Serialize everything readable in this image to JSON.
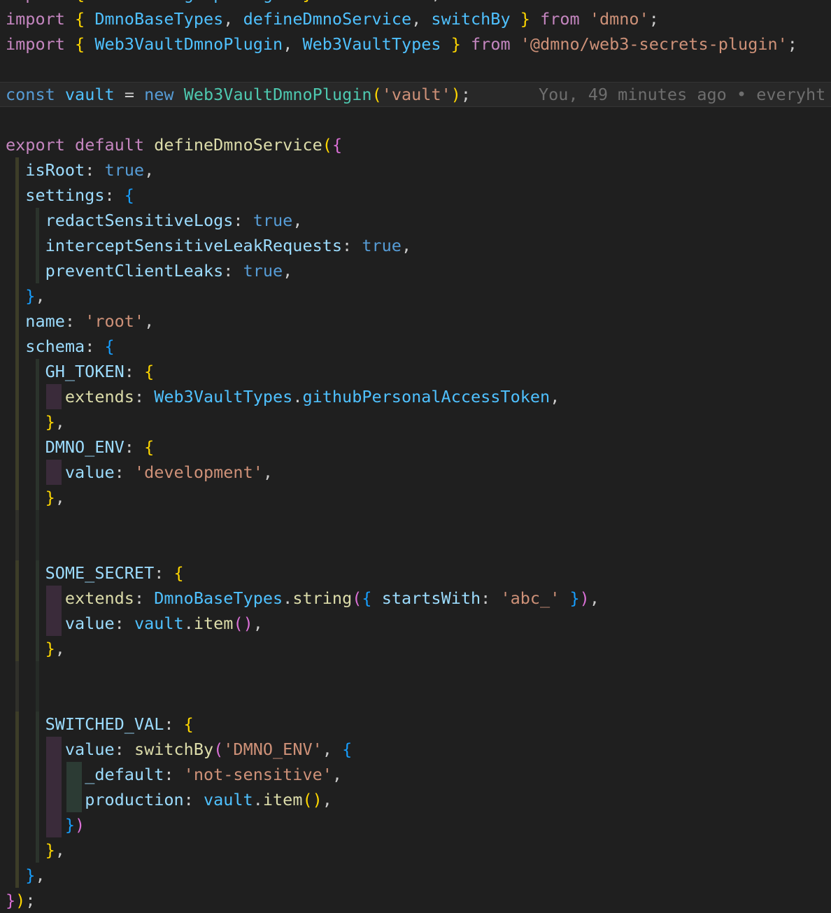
{
  "editor": {
    "language": "typescript",
    "file_kind": "dmno config",
    "background_color": "#1f1f1f",
    "current_line_background": "#282828",
    "font_size_px": 23.5,
    "line_height_px": 36
  },
  "blame": {
    "text": "You, 49 minutes ago • everyht",
    "author": "You",
    "when": "49 minutes ago",
    "message_fragment": "everyht",
    "separator": "•",
    "color": "#6e6e6e",
    "on_line": "const vault = new Web3VaultDmnoPlugin('vault');"
  },
  "colors": {
    "keyword": "#c586c0",
    "keyword_control": "#569cd6",
    "identifier": "#9cdcfe",
    "function": "#dcdcaa",
    "class": "#4ec9b0",
    "type": "#4fc1ff",
    "string": "#ce9178",
    "punctuation": "#cccccc",
    "bracket_level_1": "#ffd700",
    "bracket_level_2": "#da70d6",
    "bracket_level_3": "#179fff",
    "indent_guide_1": "#3d3d28",
    "indent_guide_2": "#2b332c",
    "indent_guide_3": "#3a2b3a",
    "indent_guide_4": "#2c3b34"
  },
  "code": {
    "lines": [
      {
        "n": 0,
        "text": "import { DmnoConfigraphPlugin } from 'dmno';",
        "clipped": true
      },
      {
        "n": 1,
        "text": "import { DmnoBaseTypes, defineDmnoService, switchBy } from 'dmno';"
      },
      {
        "n": 2,
        "text": "import { Web3VaultDmnoPlugin, Web3VaultTypes } from '@dmno/web3-secrets-plugin';"
      },
      {
        "n": 3,
        "text": ""
      },
      {
        "n": 4,
        "text": "const vault = new Web3VaultDmnoPlugin('vault');",
        "current": true
      },
      {
        "n": 5,
        "text": ""
      },
      {
        "n": 6,
        "text": "export default defineDmnoService({"
      },
      {
        "n": 7,
        "text": "  isRoot: true,"
      },
      {
        "n": 8,
        "text": "  settings: {"
      },
      {
        "n": 9,
        "text": "    redactSensitiveLogs: true,"
      },
      {
        "n": 10,
        "text": "    interceptSensitiveLeakRequests: true,"
      },
      {
        "n": 11,
        "text": "    preventClientLeaks: true,"
      },
      {
        "n": 12,
        "text": "  },"
      },
      {
        "n": 13,
        "text": "  name: 'root',"
      },
      {
        "n": 14,
        "text": "  schema: {"
      },
      {
        "n": 15,
        "text": "    GH_TOKEN: {"
      },
      {
        "n": 16,
        "text": "      extends: Web3VaultTypes.githubPersonalAccessToken,"
      },
      {
        "n": 17,
        "text": "    },"
      },
      {
        "n": 18,
        "text": "    DMNO_ENV: {"
      },
      {
        "n": 19,
        "text": "      value: 'development',"
      },
      {
        "n": 20,
        "text": "    },"
      },
      {
        "n": 21,
        "text": ""
      },
      {
        "n": 22,
        "text": ""
      },
      {
        "n": 23,
        "text": "    SOME_SECRET: {"
      },
      {
        "n": 24,
        "text": "      extends: DmnoBaseTypes.string({ startsWith: 'abc_' }),"
      },
      {
        "n": 25,
        "text": "      value: vault.item(),"
      },
      {
        "n": 26,
        "text": "    },"
      },
      {
        "n": 27,
        "text": ""
      },
      {
        "n": 28,
        "text": ""
      },
      {
        "n": 29,
        "text": "    SWITCHED_VAL: {"
      },
      {
        "n": 30,
        "text": "      value: switchBy('DMNO_ENV', {"
      },
      {
        "n": 31,
        "text": "        _default: 'not-sensitive',"
      },
      {
        "n": 32,
        "text": "        production: vault.item(),"
      },
      {
        "n": 33,
        "text": "      })"
      },
      {
        "n": 34,
        "text": "    },"
      },
      {
        "n": 35,
        "text": "  },"
      },
      {
        "n": 36,
        "text": "});"
      }
    ]
  },
  "tokens": {
    "imports": {
      "keyword_import": "import",
      "keyword_from": "from",
      "named_1": [
        "DmnoBaseTypes",
        "defineDmnoService",
        "switchBy"
      ],
      "module_1": "'dmno'",
      "named_2": [
        "Web3VaultDmnoPlugin",
        "Web3VaultTypes"
      ],
      "module_2": "'@dmno/web3-secrets-plugin'"
    },
    "vault_decl": {
      "keyword_const": "const",
      "name": "vault",
      "keyword_new": "new",
      "class": "Web3VaultDmnoPlugin",
      "arg": "'vault'"
    },
    "service": {
      "keyword_export": "export",
      "keyword_default": "default",
      "fn": "defineDmnoService",
      "isRoot": "true",
      "settings_keys": [
        "redactSensitiveLogs",
        "interceptSensitiveLeakRequests",
        "preventClientLeaks"
      ],
      "settings_values": [
        "true",
        "true",
        "true"
      ],
      "name_value": "'root'",
      "schema_keys": [
        "GH_TOKEN",
        "DMNO_ENV",
        "SOME_SECRET",
        "SWITCHED_VAL"
      ],
      "gh_token_extends": "Web3VaultTypes.githubPersonalAccessToken",
      "dmno_env_value": "'development'",
      "some_secret_extends": "DmnoBaseTypes.string({ startsWith: 'abc_' })",
      "some_secret_value": "vault.item()",
      "switched_val_fn": "switchBy",
      "switched_val_arg": "'DMNO_ENV'",
      "switched_default": "'not-sensitive'",
      "switched_production": "vault.item()"
    }
  }
}
